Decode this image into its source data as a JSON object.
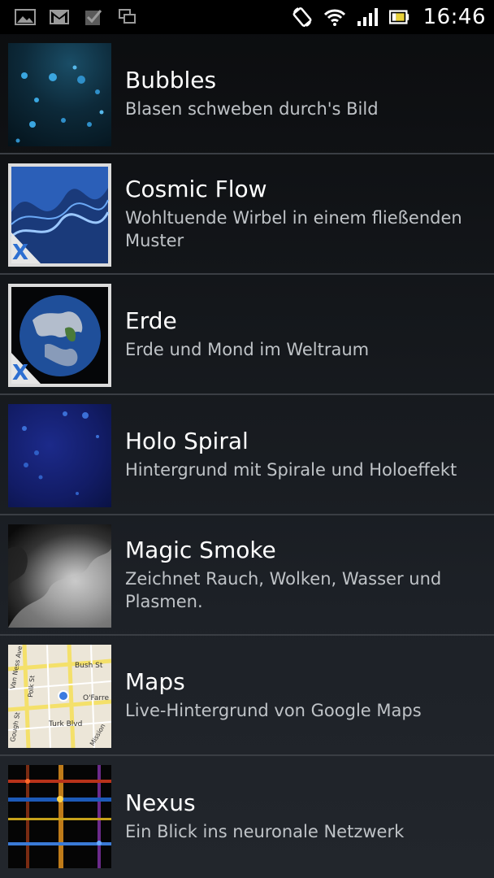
{
  "status_bar": {
    "time": "16:46",
    "left_icons": [
      "gallery-icon",
      "gmail-icon",
      "checkbox-icon",
      "screens-icon"
    ],
    "right_icons": [
      "rotate-icon",
      "wifi-icon",
      "signal-icon",
      "battery-icon"
    ]
  },
  "wallpapers": [
    {
      "title": "Bubbles",
      "description": "Blasen schweben durch's Bild"
    },
    {
      "title": "Cosmic Flow",
      "description": "Wohltuende Wirbel in einem fließenden Muster"
    },
    {
      "title": "Erde",
      "description": "Erde und Mond im Weltraum"
    },
    {
      "title": "Holo Spiral",
      "description": "Hintergrund mit Spirale und Holoeffekt"
    },
    {
      "title": "Magic Smoke",
      "description": "Zeichnet Rauch, Wolken, Wasser und Plasmen."
    },
    {
      "title": "Maps",
      "description": "Live-Hintergrund von Google Maps"
    },
    {
      "title": "Nexus",
      "description": "Ein Blick ins neuronale Netzwerk"
    }
  ],
  "map_labels": [
    "Van Ness Ave",
    "Bush St",
    "O'Farre",
    "Turk Blvd",
    "Gough St",
    "Mission",
    "Polk St"
  ],
  "badge_mark": "X"
}
